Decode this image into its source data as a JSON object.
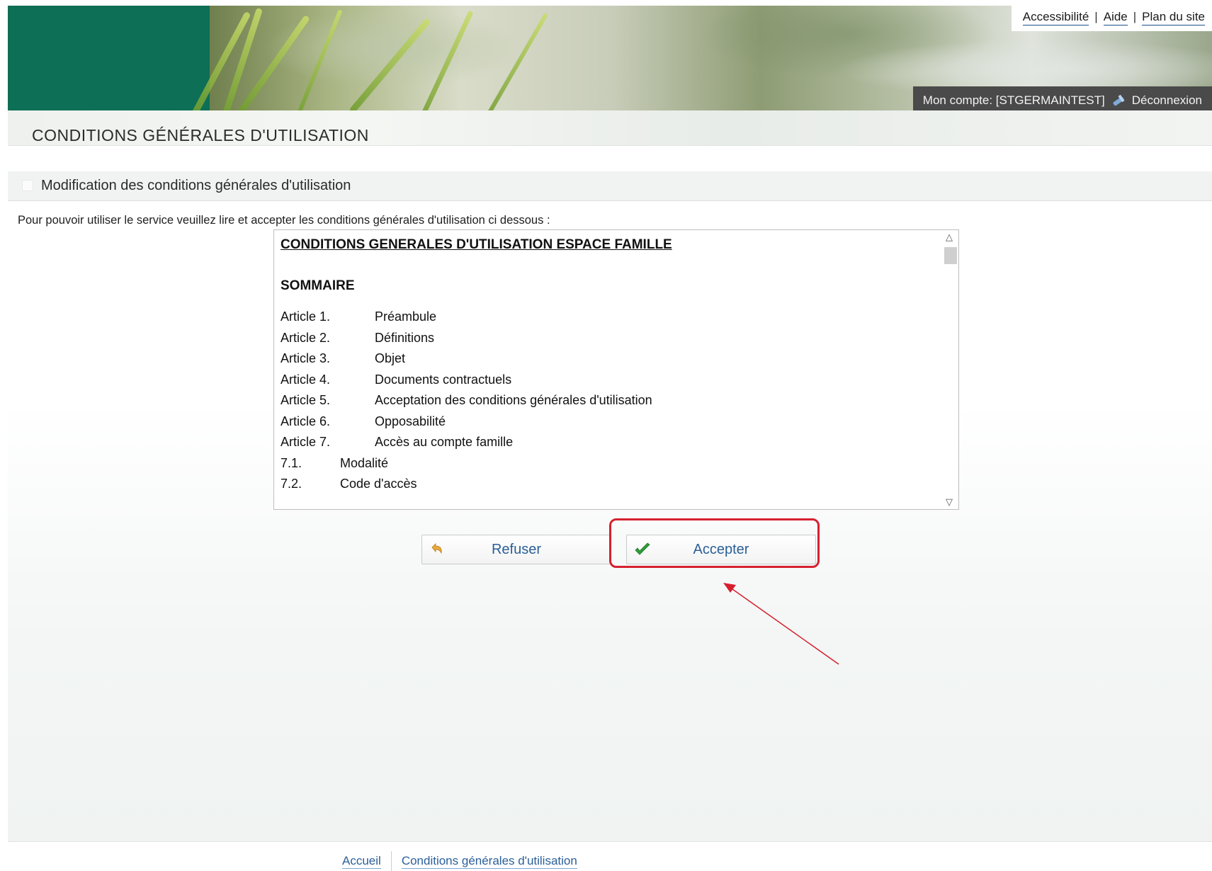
{
  "header": {
    "top_links": [
      "Accessibilité",
      "Aide",
      "Plan du site"
    ],
    "account_text": "Mon compte: [STGERMAINTEST]",
    "logout_label": "Déconnexion"
  },
  "page": {
    "title": "CONDITIONS GÉNÉRALES D'UTILISATION",
    "section_title": "Modification des conditions générales d'utilisation",
    "intro": "Pour pouvoir utiliser le service veuillez lire et accepter les conditions générales d'utilisation ci dessous :"
  },
  "terms": {
    "heading": "CONDITIONS GENERALES D'UTILISATION ESPACE FAMILLE",
    "summary_label": "SOMMAIRE",
    "items": [
      {
        "num": "Article 1.",
        "label": "Préambule"
      },
      {
        "num": "Article 2.",
        "label": "Définitions"
      },
      {
        "num": "Article 3.",
        "label": "Objet"
      },
      {
        "num": "Article 4.",
        "label": "Documents contractuels"
      },
      {
        "num": "Article 5.",
        "label": "Acceptation des conditions générales d'utilisation"
      },
      {
        "num": "Article 6.",
        "label": "Opposabilité"
      },
      {
        "num": "Article 7.",
        "label": "Accès au compte famille"
      },
      {
        "num": "7.1.",
        "label": "Modalité"
      },
      {
        "num": "7.2.",
        "label": "Code d'accès"
      }
    ]
  },
  "buttons": {
    "refuse": "Refuser",
    "accept": "Accepter"
  },
  "footer": {
    "links": [
      "Accueil",
      "Conditions générales d'utilisation"
    ]
  },
  "colors": {
    "brand_green": "#0d6f55",
    "link_blue": "#2a5f98",
    "highlight_red": "#d6202f"
  }
}
